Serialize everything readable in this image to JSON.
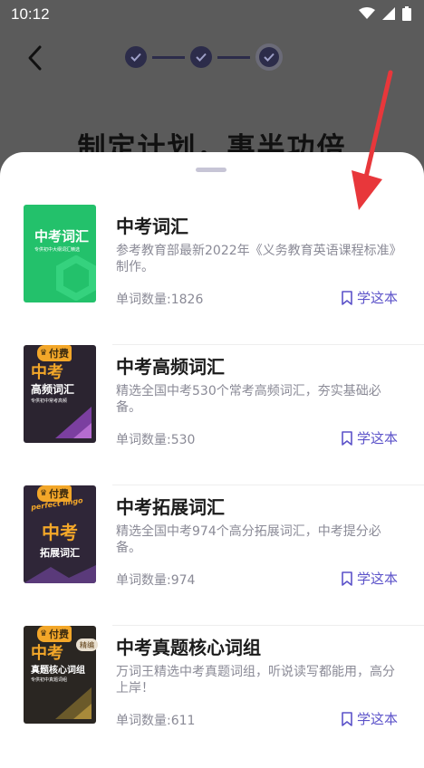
{
  "status": {
    "time": "10:12"
  },
  "background": {
    "title": "制定计划，事半功倍"
  },
  "colors": {
    "accent": "#5b52c9",
    "paid_badge": "#f3a729",
    "green_cover": "#23c16b",
    "dark_cover": "#2b2430"
  },
  "books": [
    {
      "title": "中考词汇",
      "desc": "参考教育部最新2022年《义务教育英语课程标准》制作。",
      "count": "单词数量:1826",
      "learn": "学这本",
      "cover": {
        "big": "中考词汇",
        "small": "专供初中大纲词汇精选"
      },
      "paid": ""
    },
    {
      "title": "中考高频词汇",
      "desc": "精选全国中考530个常考高频词汇，夯实基础必备。",
      "count": "单词数量:530",
      "learn": "学这本",
      "cover": {
        "big": "中考",
        "line2": "高频词汇",
        "small": "专供初中常考高频"
      },
      "paid": "付费"
    },
    {
      "title": "中考拓展词汇",
      "desc": "精选全国中考974个高分拓展词汇，中考提分必备。",
      "count": "单词数量:974",
      "learn": "学这本",
      "cover": {
        "top": "perfect lingo",
        "big": "中考",
        "line2": "拓展词汇"
      },
      "paid": "付费"
    },
    {
      "title": "中考真题核心词组",
      "desc": "万词王精选中考真题词组，听说读写都能用，高分上岸！",
      "count": "单词数量:611",
      "learn": "学这本",
      "cover": {
        "big": "中考",
        "line2": "真题核心词组",
        "small": "专供初中真题词组",
        "tag": "精编"
      },
      "paid": "付费"
    }
  ]
}
